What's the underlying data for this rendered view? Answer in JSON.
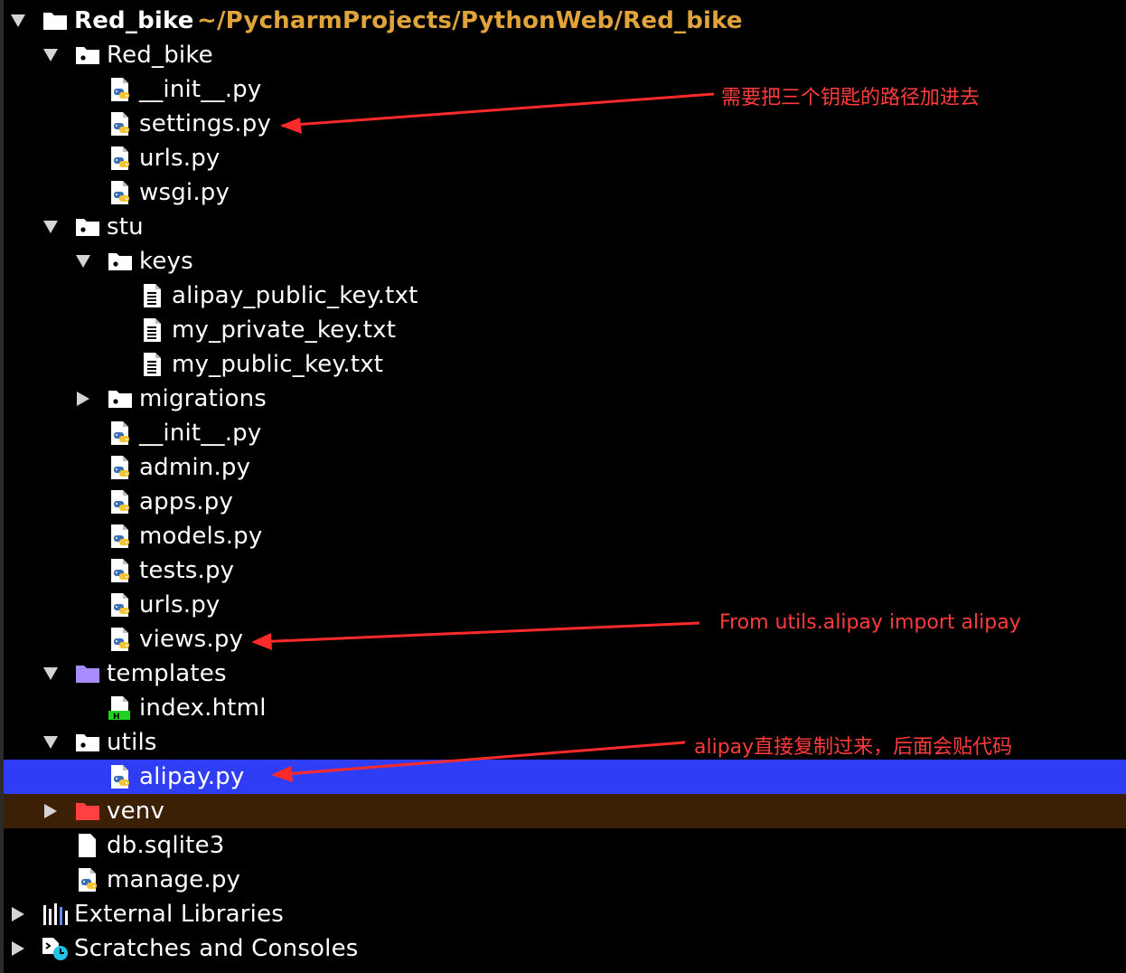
{
  "tree": {
    "root": {
      "name": "Red_bike",
      "path": "~/PycharmProjects/PythonWeb/Red_bike"
    },
    "red_bike_pkg": {
      "name": "Red_bike",
      "files": [
        "__init__.py",
        "settings.py",
        "urls.py",
        "wsgi.py"
      ]
    },
    "stu": {
      "name": "stu",
      "keys": {
        "name": "keys",
        "files": [
          "alipay_public_key.txt",
          "my_private_key.txt",
          "my_public_key.txt"
        ]
      },
      "migrations": "migrations",
      "files": [
        "__init__.py",
        "admin.py",
        "apps.py",
        "models.py",
        "tests.py",
        "urls.py",
        "views.py"
      ]
    },
    "templates": {
      "name": "templates",
      "files": [
        "index.html"
      ]
    },
    "utils": {
      "name": "utils",
      "files": [
        "alipay.py"
      ]
    },
    "venv": "venv",
    "root_files": [
      "db.sqlite3",
      "manage.py"
    ],
    "external_libraries": "External Libraries",
    "scratches": "Scratches and Consoles"
  },
  "annotations": {
    "settings_note": "需要把三个钥匙的路径加进去",
    "views_note": "From utils.alipay import alipay",
    "alipay_note": "alipay直接复制过来，后面会贴代码"
  },
  "colors": {
    "background": "#000000",
    "selected_row": "#2f3ef5",
    "excluded_row": "#3b2005",
    "path_text": "#e0a43a",
    "annotation": "#ff3b3b",
    "templates_folder": "#a98cff",
    "venv_folder": "#ff4040"
  }
}
